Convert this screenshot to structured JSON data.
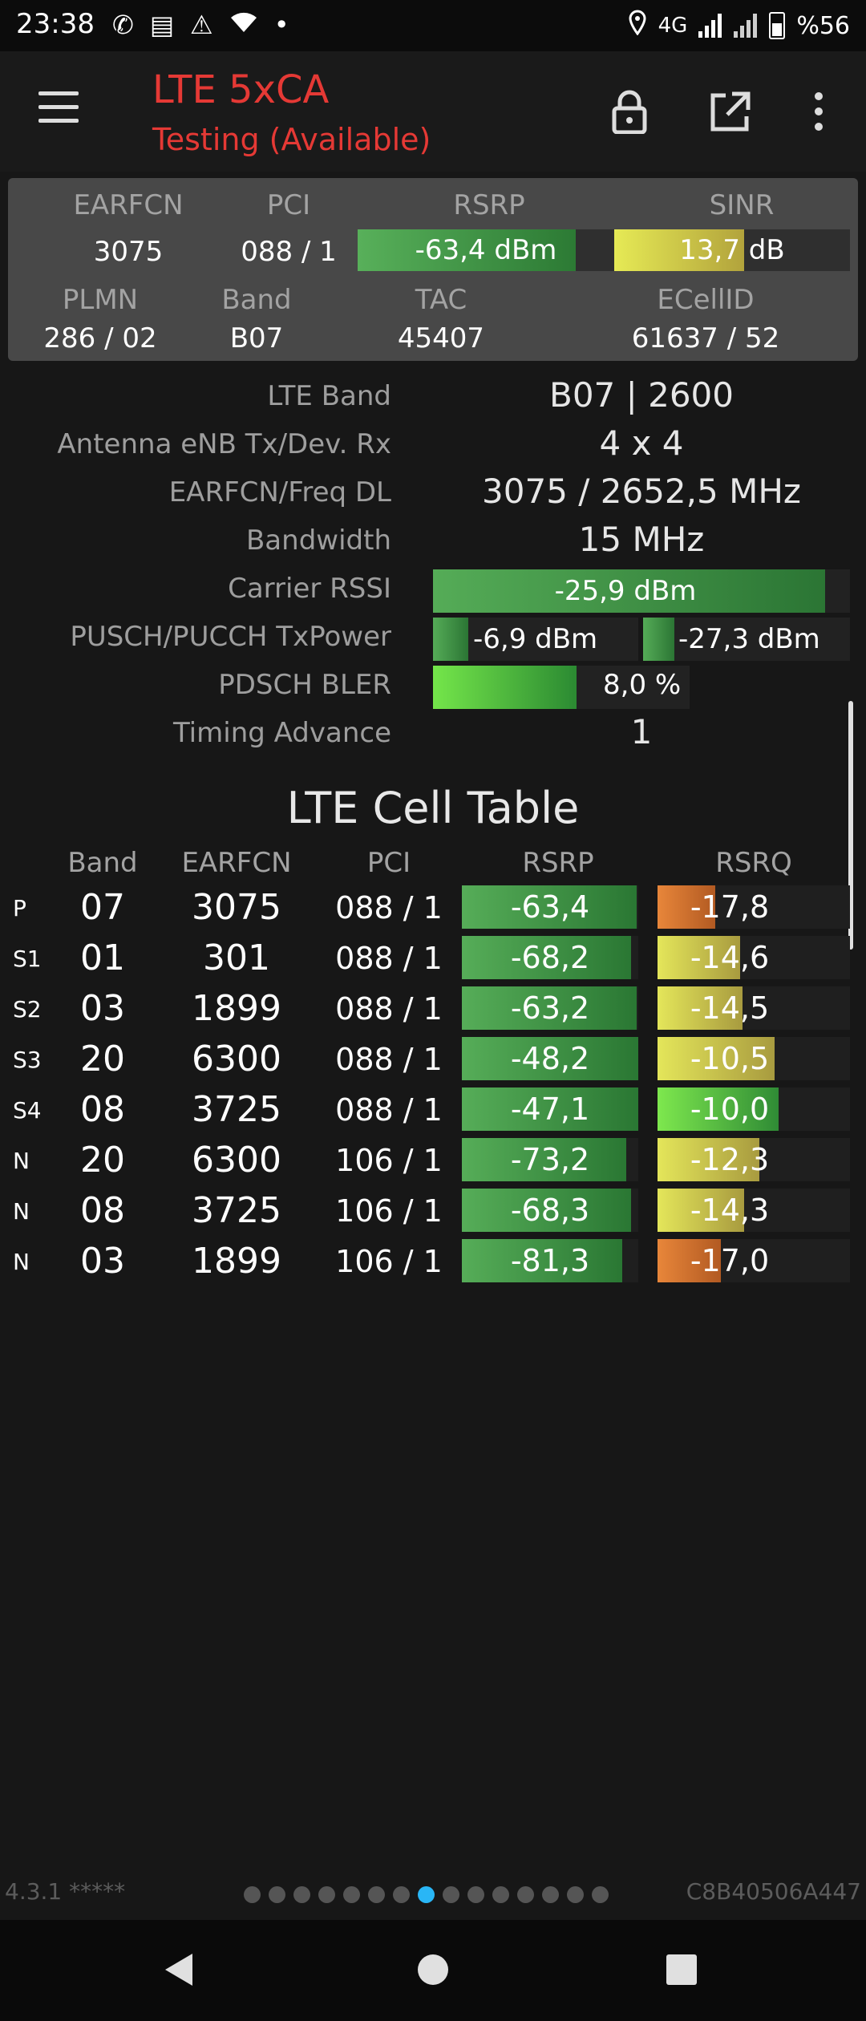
{
  "status_bar": {
    "time": "23:38",
    "left_icons": [
      "whatsapp-icon",
      "news-icon",
      "warning-icon",
      "wifi-icon",
      "dot-icon"
    ],
    "network": "4G",
    "battery": "%56"
  },
  "app_bar": {
    "title": "LTE 5xCA",
    "subtitle": "Testing (Available)",
    "icons": [
      "menu-icon",
      "lock-icon",
      "open-external-icon",
      "more-vert-icon"
    ]
  },
  "summary": {
    "labels": {
      "earfcn": "EARFCN",
      "pci": "PCI",
      "rsrp": "RSRP",
      "sinr": "SINR",
      "plmn": "PLMN",
      "band": "Band",
      "tac": "TAC",
      "ecellid": "ECellID"
    },
    "earfcn": "3075",
    "pci": "088 / 1",
    "rsrp": "-63,4 dBm",
    "rsrp_fill": 0.85,
    "sinr": "13,7 dB",
    "sinr_fill": 0.55,
    "plmn": "286 / 02",
    "band": "B07",
    "tac": "45407",
    "ecellid": "61637 / 52"
  },
  "details": {
    "lte_band_label": "LTE Band",
    "lte_band": "B07 | 2600",
    "antenna_label": "Antenna eNB Tx/Dev. Rx",
    "antenna": "4 x 4",
    "earfcn_freq_label": "EARFCN/Freq DL",
    "earfcn_freq": "3075 / 2652,5 MHz",
    "bandwidth_label": "Bandwidth",
    "bandwidth": "15 MHz",
    "carrier_rssi_label": "Carrier RSSI",
    "carrier_rssi": "-25,9 dBm",
    "carrier_rssi_fill": 0.94,
    "txpower_label": "PUSCH/PUCCH TxPower",
    "pusch": "-6,9 dBm",
    "pusch_fill": 0.17,
    "pucch": "-27,3 dBm",
    "pucch_fill": 0.15,
    "bler_label": "PDSCH BLER",
    "bler": "8,0 %",
    "bler_fill": 0.56,
    "timing_advance_label": "Timing Advance",
    "timing_advance": "1"
  },
  "cell_table": {
    "title": "LTE Cell Table",
    "headers": [
      "Band",
      "EARFCN",
      "PCI",
      "RSRP",
      "RSRQ"
    ],
    "rows": [
      {
        "type": "P",
        "band": "07",
        "earfcn": "3075",
        "pci": "088 / 1",
        "rsrp": "-63,4",
        "rsrp_fill": 0.99,
        "rsrq": "-17,8",
        "rsrq_fill": 0.3,
        "rsrq_color": "orange"
      },
      {
        "type": "S1",
        "band": "01",
        "earfcn": "301",
        "pci": "088 / 1",
        "rsrp": "-68,2",
        "rsrp_fill": 0.96,
        "rsrq": "-14,6",
        "rsrq_fill": 0.43,
        "rsrq_color": "yellow"
      },
      {
        "type": "S2",
        "band": "03",
        "earfcn": "1899",
        "pci": "088 / 1",
        "rsrp": "-63,2",
        "rsrp_fill": 0.99,
        "rsrq": "-14,5",
        "rsrq_fill": 0.44,
        "rsrq_color": "yellow"
      },
      {
        "type": "S3",
        "band": "20",
        "earfcn": "6300",
        "pci": "088 / 1",
        "rsrp": "-48,2",
        "rsrp_fill": 1.0,
        "rsrq": "-10,5",
        "rsrq_fill": 0.61,
        "rsrq_color": "yellow"
      },
      {
        "type": "S4",
        "band": "08",
        "earfcn": "3725",
        "pci": "088 / 1",
        "rsrp": "-47,1",
        "rsrp_fill": 1.0,
        "rsrq": "-10,0",
        "rsrq_fill": 0.63,
        "rsrq_color": "green"
      },
      {
        "type": "N",
        "band": "20",
        "earfcn": "6300",
        "pci": "106 / 1",
        "rsrp": "-73,2",
        "rsrp_fill": 0.93,
        "rsrq": "-12,3",
        "rsrq_fill": 0.53,
        "rsrq_color": "yellow"
      },
      {
        "type": "N",
        "band": "08",
        "earfcn": "3725",
        "pci": "106 / 1",
        "rsrp": "-68,3",
        "rsrp_fill": 0.96,
        "rsrq": "-14,3",
        "rsrq_fill": 0.45,
        "rsrq_color": "yellow"
      },
      {
        "type": "N",
        "band": "03",
        "earfcn": "1899",
        "pci": "106 / 1",
        "rsrp": "-81,3",
        "rsrp_fill": 0.91,
        "rsrq": "-17,0",
        "rsrq_fill": 0.33,
        "rsrq_color": "orange"
      }
    ]
  },
  "footer": {
    "version": "4.3.1 *****",
    "cell_id": "C8B40506A447",
    "page_count": 15,
    "active_page": 8
  },
  "colors": {
    "accent": "#e53935",
    "green_dark": "#2e7d32",
    "green_light": "#66bb6a",
    "bright_green": "#76ff03",
    "yellow": "#d4d84a",
    "orange": "#e07b2c",
    "dot_active": "#29b6f6"
  }
}
